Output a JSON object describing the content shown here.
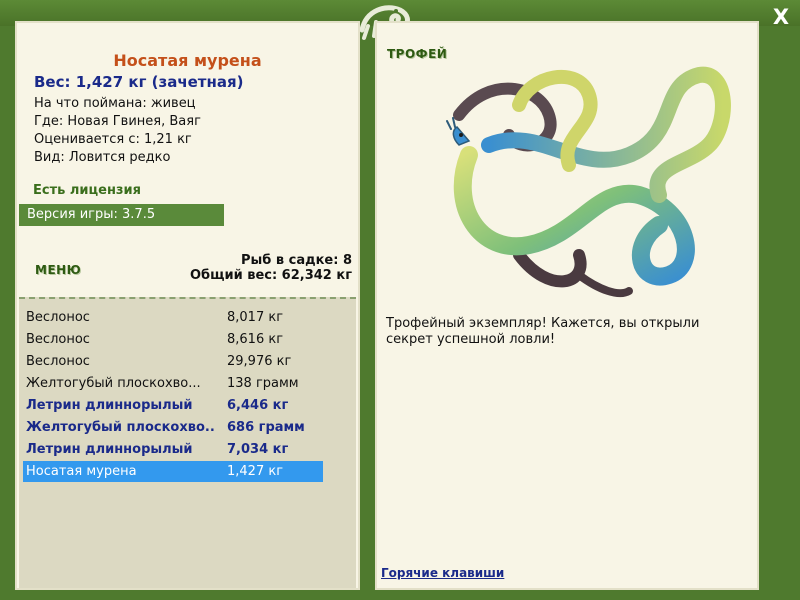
{
  "window": {
    "close_glyph": "X"
  },
  "fish": {
    "name": "Носатая мурена",
    "weight_line": "Вес: 1,427 кг (зачетная)",
    "details": [
      "На что поймана: живец",
      "Где: Новая Гвинея, Ваяг",
      "Оценивается с: 1,21 кг",
      "Вид: Ловится редко"
    ]
  },
  "license": "Есть лицензия",
  "version": "Версия игры: 3.7.5",
  "menu_label": "МЕНЮ",
  "keep": {
    "count_line": "Рыб в садке: 8",
    "total_line": "Общий вес: 62,342 кг"
  },
  "catches": [
    {
      "name": "Веслонос",
      "weight": "8,017 кг",
      "style": "normal"
    },
    {
      "name": "Веслонос",
      "weight": "8,616 кг",
      "style": "normal"
    },
    {
      "name": "Веслонос",
      "weight": "29,976 кг",
      "style": "normal"
    },
    {
      "name": "Желтогубый плоскохво...",
      "weight": "138 грамм",
      "style": "normal"
    },
    {
      "name": "Летрин длиннорылый",
      "weight": "6,446 кг",
      "style": "bold"
    },
    {
      "name": "Желтогубый плоскохво...",
      "weight": "686 грамм",
      "style": "bold"
    },
    {
      "name": "Летрин длиннорылый",
      "weight": "7,034 кг",
      "style": "bold"
    },
    {
      "name": "Носатая мурена",
      "weight": "1,427 кг",
      "style": "selected"
    }
  ],
  "trophy": {
    "label": "ТРОФЕЙ",
    "text": "Трофейный экземпляр! Кажется, вы открыли секрет успешной ловли!",
    "image_icon": "moray-eel-illustration"
  },
  "hotkeys": "Горячие клавиши",
  "colors": {
    "frame": "#4f7a2e",
    "panel": "#f8f5e6",
    "list_bg": "#dcd9c2",
    "selected": "#3399ee",
    "title": "#c4501a",
    "bold_text": "#1a2a8a",
    "version_bar": "#5a8a3a"
  }
}
